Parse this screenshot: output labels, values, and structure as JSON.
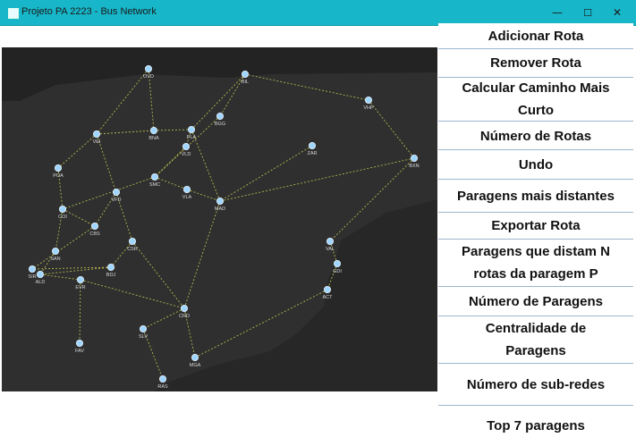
{
  "window": {
    "title": "Projeto PA 2223 - Bus Network",
    "controls": {
      "minimize": "—",
      "maximize": "☐",
      "close": "✕"
    }
  },
  "menu": {
    "buttons": [
      {
        "label": "Adicionar Rota"
      },
      {
        "label": "Remover Rota"
      },
      {
        "label": "Calcular Caminho Mais Curto"
      },
      {
        "label": "Número de Rotas"
      },
      {
        "label": "Undo"
      },
      {
        "label": "Paragens mais distantes"
      },
      {
        "label": "Exportar Rota"
      },
      {
        "label": "Paragens que distam N rotas da paragem P"
      },
      {
        "label": "Número de Paragens"
      },
      {
        "label": "Centralidade de Paragens"
      },
      {
        "label": "Número de sub-redes"
      },
      {
        "label": "Top 7 paragens"
      }
    ]
  },
  "map": {
    "colors": {
      "background": "#272727",
      "node": "#9fd6ff",
      "node_label": "#d8d8d8",
      "edge": "#c7cc55"
    },
    "nodes": [
      {
        "id": "OVD",
        "label": "OVD"
      },
      {
        "id": "BIL",
        "label": "BIL"
      },
      {
        "id": "VHP",
        "label": "VHP"
      },
      {
        "id": "VEI",
        "label": "VEI"
      },
      {
        "id": "BNA",
        "label": "BNA"
      },
      {
        "id": "PLA",
        "label": "PLA"
      },
      {
        "id": "BGG",
        "label": "BGG"
      },
      {
        "id": "VLD",
        "label": "VLD"
      },
      {
        "id": "ZAR",
        "label": "ZAR"
      },
      {
        "id": "BXN",
        "label": "BXN"
      },
      {
        "id": "POA",
        "label": "POA"
      },
      {
        "id": "SMC",
        "label": "SMC"
      },
      {
        "id": "VFD",
        "label": "VFD"
      },
      {
        "id": "VLA",
        "label": "VLA"
      },
      {
        "id": "MAD",
        "label": "MAD"
      },
      {
        "id": "COI",
        "label": "COI"
      },
      {
        "id": "CBS",
        "label": "CBS"
      },
      {
        "id": "VAL",
        "label": "VAL"
      },
      {
        "id": "SAN",
        "label": "SAN"
      },
      {
        "id": "CSR",
        "label": "CSR"
      },
      {
        "id": "GDI",
        "label": "GDI"
      },
      {
        "id": "BDJ",
        "label": "BDJ"
      },
      {
        "id": "SIR",
        "label": "SIR"
      },
      {
        "id": "ALD",
        "label": "ALD"
      },
      {
        "id": "EVR",
        "label": "EVR"
      },
      {
        "id": "ACT",
        "label": "ACT"
      },
      {
        "id": "CRD",
        "label": "CRD"
      },
      {
        "id": "SLV",
        "label": "SLV"
      },
      {
        "id": "FAV",
        "label": "FAV"
      },
      {
        "id": "MGA",
        "label": "MGA"
      },
      {
        "id": "RAS",
        "label": "RAS"
      }
    ],
    "edges": [
      [
        "OVD",
        "VEI"
      ],
      [
        "OVD",
        "BNA"
      ],
      [
        "BIL",
        "BGG"
      ],
      [
        "BIL",
        "VHP"
      ],
      [
        "BIL",
        "PLA"
      ],
      [
        "VHP",
        "BXN"
      ],
      [
        "VEI",
        "BNA"
      ],
      [
        "VEI",
        "POA"
      ],
      [
        "VEI",
        "CSR"
      ],
      [
        "BNA",
        "PLA"
      ],
      [
        "PLA",
        "VLD"
      ],
      [
        "PLA",
        "MAD"
      ],
      [
        "BGG",
        "SMC"
      ],
      [
        "VLD",
        "SMC"
      ],
      [
        "ZAR",
        "MAD"
      ],
      [
        "BXN",
        "MAD"
      ],
      [
        "BXN",
        "VAL"
      ],
      [
        "POA",
        "COI"
      ],
      [
        "SMC",
        "COI"
      ],
      [
        "SMC",
        "VLA"
      ],
      [
        "VLA",
        "MAD"
      ],
      [
        "MAD",
        "CRD"
      ],
      [
        "VFD",
        "CBS"
      ],
      [
        "COI",
        "CBS"
      ],
      [
        "COI",
        "SAN"
      ],
      [
        "CBS",
        "SIR"
      ],
      [
        "CSR",
        "BDJ"
      ],
      [
        "CSR",
        "CRD"
      ],
      [
        "SAN",
        "ALD"
      ],
      [
        "BDJ",
        "ALD"
      ],
      [
        "BDJ",
        "SIR"
      ],
      [
        "ALD",
        "EVR"
      ],
      [
        "EVR",
        "CRD"
      ],
      [
        "EVR",
        "FAV"
      ],
      [
        "CRD",
        "SLV"
      ],
      [
        "CRD",
        "MGA"
      ],
      [
        "SLV",
        "RAS"
      ],
      [
        "VAL",
        "GDI"
      ],
      [
        "GDI",
        "ACT"
      ],
      [
        "ACT",
        "MGA"
      ]
    ]
  }
}
